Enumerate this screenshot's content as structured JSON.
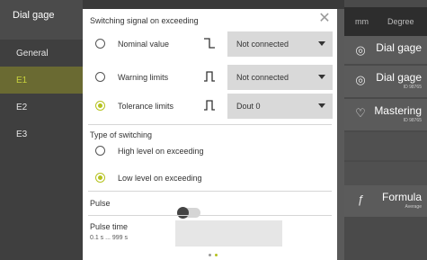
{
  "sidebar": {
    "title": "Dial gage",
    "items": [
      {
        "label": "General",
        "selected": false
      },
      {
        "label": "E1",
        "selected": true
      },
      {
        "label": "E2",
        "selected": false
      },
      {
        "label": "E3",
        "selected": false
      }
    ]
  },
  "right_panel": {
    "units": {
      "length": "mm",
      "angle": "Degree"
    },
    "rows": [
      {
        "label": "Dial gage",
        "sub": "",
        "icon": "gauge-icon"
      },
      {
        "label": "Dial gage",
        "sub": "ID 98765",
        "icon": "gauge-icon"
      },
      {
        "label": "Mastering",
        "sub": "ID 98765",
        "icon": "mastering-icon"
      },
      {
        "label": "Formula",
        "sub": "Average",
        "icon": "formula-icon"
      }
    ]
  },
  "dialog": {
    "title": "Switching signal on exceeding",
    "signals": [
      {
        "label": "Nominal value",
        "selected": false,
        "icon": "signal-step-icon",
        "value": "Not connected"
      },
      {
        "label": "Warning limits",
        "selected": false,
        "icon": "signal-pulse-icon",
        "value": "Not connected"
      },
      {
        "label": "Tolerance limits",
        "selected": true,
        "icon": "signal-pulse-icon",
        "value": "Dout 0"
      }
    ],
    "switching": {
      "title": "Type of switching",
      "options": [
        {
          "label": "High level on exceeding",
          "selected": false
        },
        {
          "label": "Low level on exceeding",
          "selected": true
        }
      ]
    },
    "pulse": {
      "label": "Pulse",
      "enabled": false
    },
    "pulse_time": {
      "label": "Pulse time",
      "range": "0.1 s ... 999 s",
      "value": ""
    },
    "pages": {
      "count": 2,
      "current": 2
    }
  },
  "colors": {
    "accent": "#b5c21e",
    "selected_bg": "#6a6a32",
    "orange": "#e8a030"
  }
}
